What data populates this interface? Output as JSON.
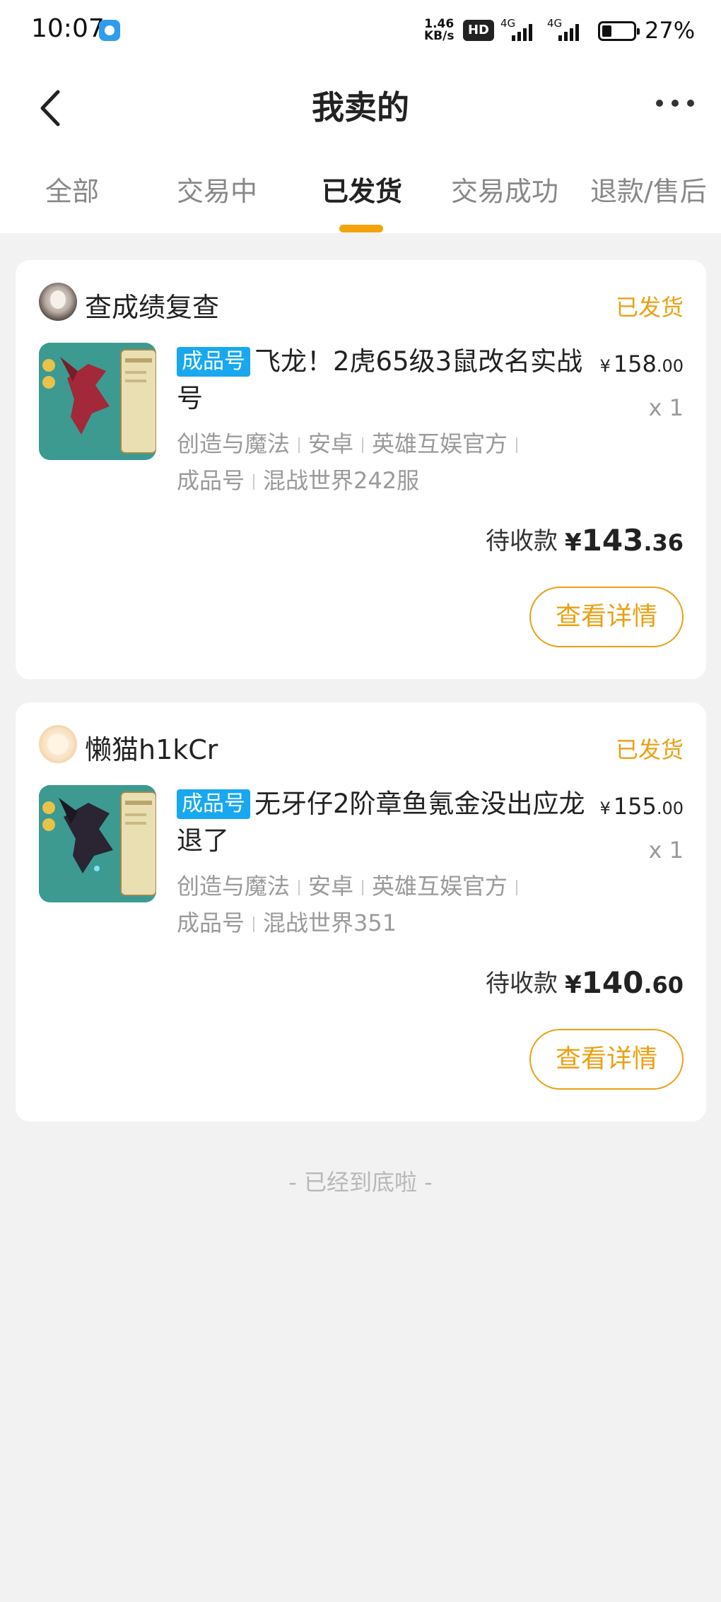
{
  "status_bar": {
    "time": "10:07",
    "net_speed_value": "1.46",
    "net_speed_unit": "KB/s",
    "hd_label": "HD",
    "signal_1_label": "4G",
    "signal_2_label": "4G",
    "battery_percent": "27%",
    "battery_level": 0.27
  },
  "header": {
    "title": "我卖的"
  },
  "tabs": [
    {
      "label": "全部",
      "active": false
    },
    {
      "label": "交易中",
      "active": false
    },
    {
      "label": "已发货",
      "active": true
    },
    {
      "label": "交易成功",
      "active": false
    },
    {
      "label": "退款/售后",
      "active": false
    }
  ],
  "orders": [
    {
      "seller": "查成绩复查",
      "status": "已发货",
      "tag": "成品号",
      "title": "飞龙！2虎65级3鼠改名实战号",
      "meta": [
        "创造与魔法",
        "安卓",
        "英雄互娱官方",
        "成品号",
        "混战世界242服"
      ],
      "price_symbol": "¥",
      "price_int": "158",
      "price_dec": ".00",
      "quantity": "x 1",
      "amount_label": "待收款",
      "amount_symbol": "¥",
      "amount_int": "143",
      "amount_dec": ".36",
      "button": "查看详情"
    },
    {
      "seller": "懒猫h1kCr",
      "status": "已发货",
      "tag": "成品号",
      "title": "无牙仔2阶章鱼氪金没出应龙退了",
      "meta": [
        "创造与魔法",
        "安卓",
        "英雄互娱官方",
        "成品号",
        "混战世界351"
      ],
      "price_symbol": "¥",
      "price_int": "155",
      "price_dec": ".00",
      "quantity": "x 1",
      "amount_label": "待收款",
      "amount_symbol": "¥",
      "amount_int": "140",
      "amount_dec": ".60",
      "button": "查看详情"
    }
  ],
  "footer": {
    "end_text": "- 已经到底啦 -"
  },
  "colors": {
    "accent": "#eba013",
    "tab_indicator": "#f5a30b",
    "tag_blue": "#17a8f0",
    "background": "#f2f2f2"
  }
}
